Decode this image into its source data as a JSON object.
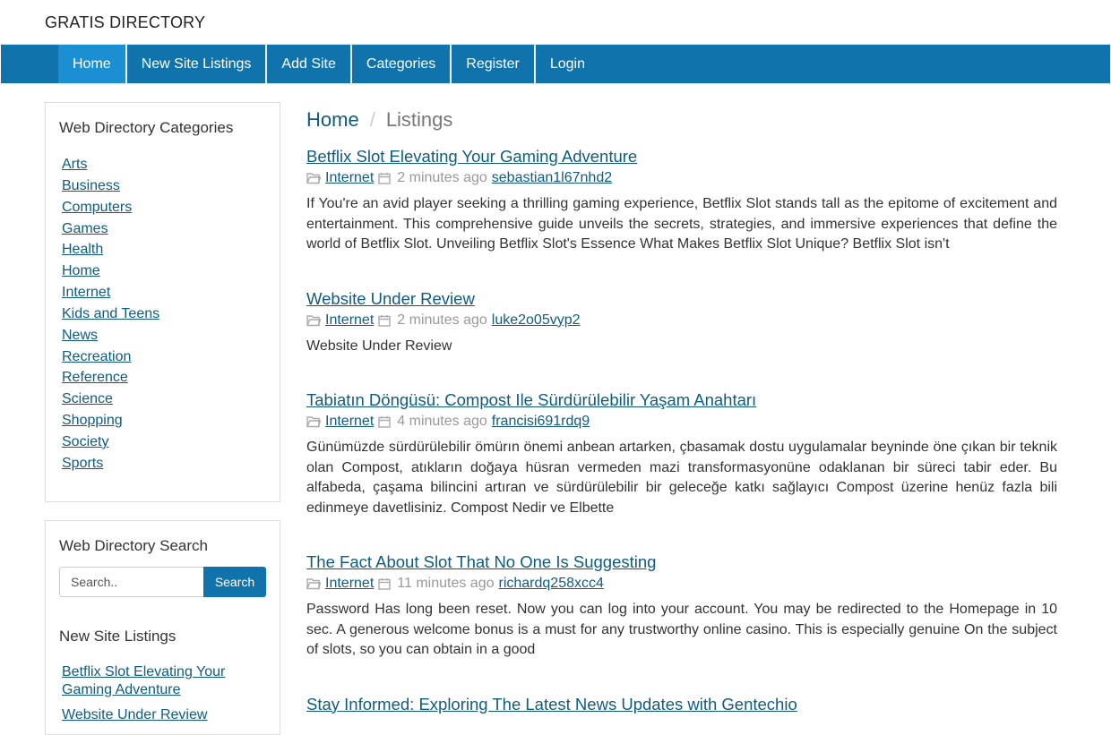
{
  "brand": "GRATIS DIRECTORY",
  "nav": [
    "Home",
    "New Site Listings",
    "Add Site",
    "Categories",
    "Register",
    "Login"
  ],
  "categories_panel": {
    "title": "Web Directory Categories",
    "items": [
      "Arts",
      "Business",
      "Computers",
      "Games",
      "Health",
      "Home",
      "Internet",
      "Kids and Teens",
      "News",
      "Recreation",
      "Reference",
      "Science",
      "Shopping",
      "Society",
      "Sports"
    ]
  },
  "search_panel": {
    "title": "Web Directory Search",
    "placeholder": "Search..",
    "button": "Search",
    "new_title": "New Site Listings",
    "new_items": [
      "Betflix Slot Elevating Your Gaming Adventure",
      "Website Under Review"
    ]
  },
  "breadcrumb": {
    "home": "Home",
    "sep": "/",
    "current": "Listings"
  },
  "listings": [
    {
      "title": "Betflix Slot Elevating Your Gaming Adventure",
      "category": "Internet",
      "time": "2 minutes ago",
      "user": "sebastian1l67nhd2",
      "desc": "If You're an avid player seeking a thrilling gaming experience, Betflix Slot stands tall as the epitome of excitement and entertainment. This comprehensive guide unveils the secrets, strategies, and immersive experiences that define the world of Betflix Slot. Unveiling Betflix Slot's Essence What Makes Betflix Slot Unique? Betflix Slot isn't"
    },
    {
      "title": "Website Under Review",
      "category": "Internet",
      "time": "2 minutes ago",
      "user": "luke2o05vyp2",
      "desc": "Website Under Review"
    },
    {
      "title": "Tabiatın Döngüsü: Compost Ile Sürdürülebilir Yaşam Anahtarı",
      "category": "Internet",
      "time": "4 minutes ago",
      "user": "francisi691rdq9",
      "desc": "Günümüzde sürdürülebilir ömürın önemi anbean artarken, çbasamak dostu uygulamalar beyninde öne çıkan bir teknik olan Compost, atıkların doğaya hüsran vermeden mazi transformasyonüne odaklanan bir süreci tabir eder. Bu alfabeda, çaşama bilincini artıran ve sürdürülebilir bir geleceğe katkı sağlayıcı Compost üzerine henüz fazla bili edinmeye davetlisiniz. Compost Nedir ve Elbette"
    },
    {
      "title": "The Fact About Slot That No One Is Suggesting",
      "category": "Internet",
      "time": "11 minutes ago",
      "user": "richardq258xcc4",
      "desc": "Password Has long been reset. Now you can log into your account. You may be redirected to the Homepage in 10 sec. A generous welcome bonus is a must for any trustworthy online casino. This is especially genuine On the subject of slots, so you can obtain in a good"
    },
    {
      "title": "Stay Informed: Exploring The Latest News Updates with Gentechio",
      "category": "",
      "time": "",
      "user": "",
      "desc": ""
    }
  ]
}
